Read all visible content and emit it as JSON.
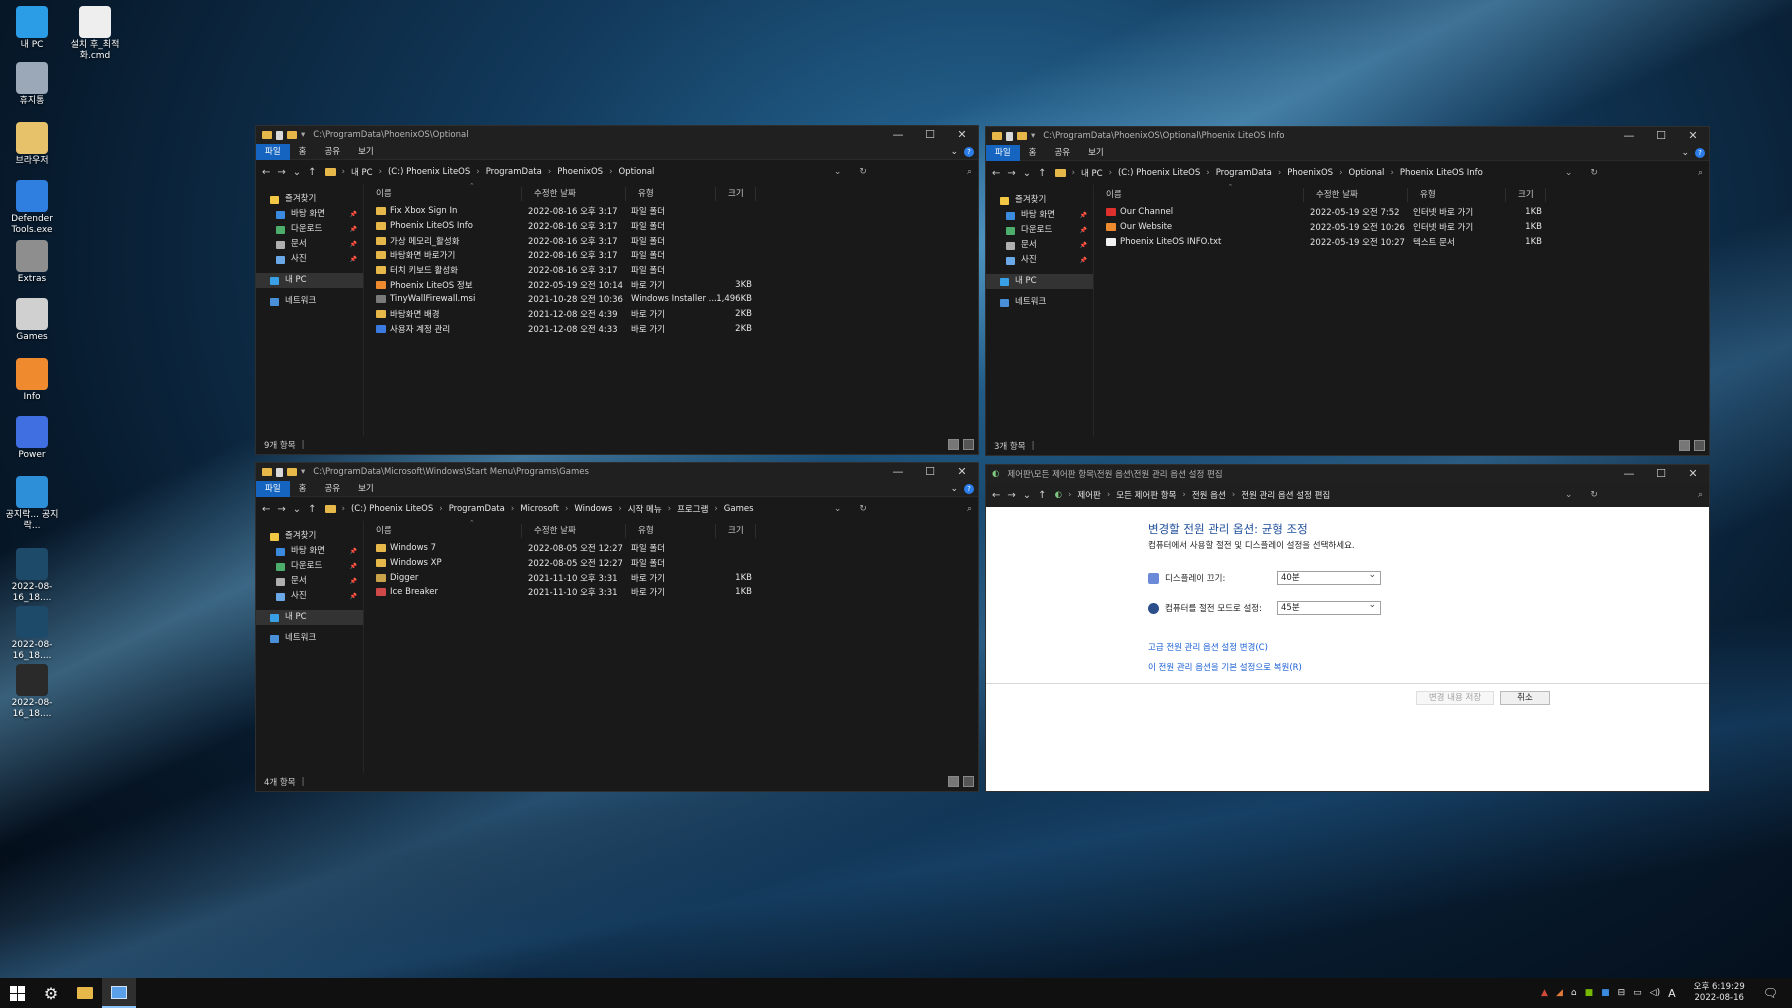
{
  "desktop": {
    "icons": [
      {
        "label": "내 PC",
        "color": "#2b9de6"
      },
      {
        "label": "휴지통",
        "color": "#9aa8b8"
      },
      {
        "label": "브라우저",
        "color": "#e8c26a"
      },
      {
        "label": "Defender Tools.exe",
        "color": "#2f7fe0"
      },
      {
        "label": "Extras",
        "color": "#8e8e8e"
      },
      {
        "label": "Games",
        "color": "#d0d0d0"
      },
      {
        "label": "Info",
        "color": "#f08a2e"
      },
      {
        "label": "Power",
        "color": "#3f6fe0"
      },
      {
        "label": "공지락... 공지락...",
        "color": "#2d8fd8"
      },
      {
        "label": "2022-08-16_18....",
        "color": "#1e4a6a"
      },
      {
        "label": "2022-08-16_18....",
        "color": "#1e4a6a"
      },
      {
        "label": "2022-08-16_18....",
        "color": "#2a2a2a"
      },
      {
        "label": "설치 후_최적화.cmd",
        "color": "#eeeeee"
      }
    ]
  },
  "common": {
    "ribbon": {
      "file": "파일",
      "home": "홈",
      "share": "공유",
      "view": "보기"
    },
    "nav": {
      "quick": "즐겨찾기",
      "desktop": "바탕 화면",
      "downloads": "다운로드",
      "documents": "문서",
      "pictures": "사진",
      "thispc": "내 PC",
      "network": "네트워크"
    },
    "cols": {
      "name": "이름",
      "date": "수정한 날짜",
      "type": "유형",
      "size": "크기"
    }
  },
  "win1": {
    "title": "C:\\ProgramData\\PhoenixOS\\Optional",
    "crumbs": [
      "내 PC",
      "(C:) Phoenix LiteOS",
      "ProgramData",
      "PhoenixOS",
      "Optional"
    ],
    "status": "9개 항목",
    "files": [
      {
        "name": "Fix Xbox Sign In",
        "date": "2022-08-16 오후 3:17",
        "type": "파일 폴더",
        "size": "",
        "icon": "#e6b84a"
      },
      {
        "name": "Phoenix LiteOS Info",
        "date": "2022-08-16 오후 3:17",
        "type": "파일 폴더",
        "size": "",
        "icon": "#e6b84a"
      },
      {
        "name": "가상 메모리_활성화",
        "date": "2022-08-16 오후 3:17",
        "type": "파일 폴더",
        "size": "",
        "icon": "#e6b84a"
      },
      {
        "name": "바탕화면 바로가기",
        "date": "2022-08-16 오후 3:17",
        "type": "파일 폴더",
        "size": "",
        "icon": "#e6b84a"
      },
      {
        "name": "터치 키보드 활성화",
        "date": "2022-08-16 오후 3:17",
        "type": "파일 폴더",
        "size": "",
        "icon": "#e6b84a"
      },
      {
        "name": "Phoenix LiteOS 정보",
        "date": "2022-05-19 오전 10:14",
        "type": "바로 가기",
        "size": "3KB",
        "icon": "#f08a2e"
      },
      {
        "name": "TinyWallFirewall.msi",
        "date": "2021-10-28 오전 10:36",
        "type": "Windows Installer ...",
        "size": "1,496KB",
        "icon": "#7a7a7a"
      },
      {
        "name": "바탕화면 배경",
        "date": "2021-12-08 오전 4:39",
        "type": "바로 가기",
        "size": "2KB",
        "icon": "#e6b84a"
      },
      {
        "name": "사용자 계정 관리",
        "date": "2021-12-08 오전 4:33",
        "type": "바로 가기",
        "size": "2KB",
        "icon": "#3b7be0"
      }
    ]
  },
  "win2": {
    "title": "C:\\ProgramData\\PhoenixOS\\Optional\\Phoenix LiteOS Info",
    "crumbs": [
      "내 PC",
      "(C:) Phoenix LiteOS",
      "ProgramData",
      "PhoenixOS",
      "Optional",
      "Phoenix LiteOS Info"
    ],
    "status": "3개 항목",
    "files": [
      {
        "name": "Our Channel",
        "date": "2022-05-19 오전 7:52",
        "type": "인터넷 바로 가기",
        "size": "1KB",
        "icon": "#e0302e"
      },
      {
        "name": "Our Website",
        "date": "2022-05-19 오전 10:26",
        "type": "인터넷 바로 가기",
        "size": "1KB",
        "icon": "#f08a2e"
      },
      {
        "name": "Phoenix LiteOS INFO.txt",
        "date": "2022-05-19 오전 10:27",
        "type": "텍스트 문서",
        "size": "1KB",
        "icon": "#f2f2f2"
      }
    ]
  },
  "win3": {
    "title": "C:\\ProgramData\\Microsoft\\Windows\\Start Menu\\Programs\\Games",
    "crumbs": [
      "(C:) Phoenix LiteOS",
      "ProgramData",
      "Microsoft",
      "Windows",
      "시작 메뉴",
      "프로그램",
      "Games"
    ],
    "status": "4개 항목",
    "files": [
      {
        "name": "Windows 7",
        "date": "2022-08-05 오전 12:27",
        "type": "파일 폴더",
        "size": "",
        "icon": "#e6b84a"
      },
      {
        "name": "Windows XP",
        "date": "2022-08-05 오전 12:27",
        "type": "파일 폴더",
        "size": "",
        "icon": "#e6b84a"
      },
      {
        "name": "Digger",
        "date": "2021-11-10 오후 3:31",
        "type": "바로 가기",
        "size": "1KB",
        "icon": "#c9a24a"
      },
      {
        "name": "Ice Breaker",
        "date": "2021-11-10 오후 3:31",
        "type": "바로 가기",
        "size": "1KB",
        "icon": "#d04a4a"
      }
    ]
  },
  "win4": {
    "title": "제어판\\모든 제어판 항목\\전원 옵션\\전원 관리 옵션 설정 편집",
    "crumbs": [
      "제어판",
      "모든 제어판 항목",
      "전원 옵션",
      "전원 관리 옵션 설정 편집"
    ],
    "heading": "변경할 전원 관리 옵션: 균형 조정",
    "subheading": "컴퓨터에서 사용할 절전 및 디스플레이 설정을 선택하세요.",
    "display_off_label": "디스플레이 끄기:",
    "display_off_value": "40분",
    "sleep_label": "컴퓨터를 절전 모드로 설정:",
    "sleep_value": "45분",
    "link_advanced": "고급 전원 관리 옵션 설정 변경(C)",
    "link_restore": "이 전원 관리 옵션을 기본 설정으로 복원(R)",
    "save_label": "변경 내용 저장",
    "cancel_label": "취소"
  },
  "taskbar": {
    "time": "오후 6:19:29",
    "date": "2022-08-16",
    "ime": "A"
  }
}
